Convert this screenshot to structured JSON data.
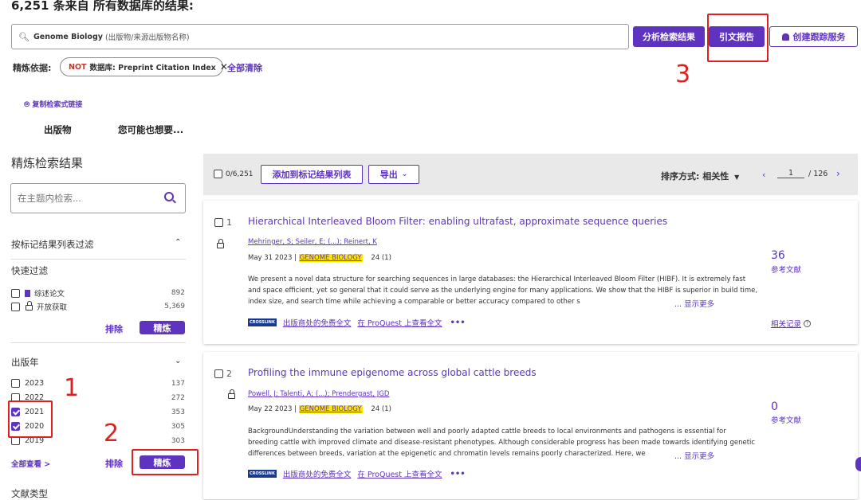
{
  "header": {
    "heading": "6,251 条来自 所有数据库的结果:",
    "search": {
      "term": "Genome Biology",
      "hint": "(出版物/来源出版物名称)"
    },
    "buttons": {
      "analyze": "分析检索结果",
      "citation_report": "引文报告",
      "create_alert": "创建跟踪服务"
    },
    "refine_label": "精炼依据:",
    "filter_chip": {
      "not": "NOT",
      "text": "数据库: Preprint Citation Index"
    },
    "clear_all": "全部清除",
    "copy_link": "复制检索式链接",
    "tabs": [
      "出版物",
      "您可能也想要..."
    ]
  },
  "annotations": {
    "one": "1",
    "two": "2",
    "three": "3"
  },
  "sidebar": {
    "title": "精炼检索结果",
    "search_placeholder": "在主题内检索...",
    "filter_by_marked": "按标记结果列表过滤",
    "quick_filter": {
      "title": "快速过滤",
      "items": [
        {
          "label": "综述论文",
          "count": "892"
        },
        {
          "label": "开放获取",
          "count": "5,369"
        }
      ],
      "exclude": "排除",
      "refine": "精炼"
    },
    "pub_years": {
      "title": "出版年",
      "items": [
        {
          "label": "2023",
          "count": "137",
          "checked": false
        },
        {
          "label": "2022",
          "count": "272",
          "checked": false
        },
        {
          "label": "2021",
          "count": "353",
          "checked": true
        },
        {
          "label": "2020",
          "count": "305",
          "checked": true
        },
        {
          "label": "2019",
          "count": "303",
          "checked": false
        }
      ],
      "see_all": "全部查看 >",
      "exclude": "排除",
      "refine": "精炼"
    },
    "doc_types_partial": "文献类型"
  },
  "toolbar": {
    "selected": "0/6,251",
    "add_to_marked": "添加到标记结果列表",
    "export": "导出",
    "sort": "排序方式: 相关性",
    "page": "1",
    "total_pages": "/ 126"
  },
  "results": [
    {
      "index": "1",
      "title": "Hierarchical Interleaved Bloom Filter: enabling ultrafast, approximate sequence queries",
      "authors": "Mehringer, S; Seiler, E; (...); Reinert, K",
      "date": "May 31 2023 |",
      "journal": "GENOME BIOLOGY",
      "volume": "24 (1)",
      "abstract": "We present a novel data structure for searching sequences in large databases: the Hierarchical Interleaved Bloom Filter (HIBF). It is extremely fast and space efficient, yet so general that it could serve as the underlying engine for many applications. We show that the HIBF is superior in build time, index size, and search time while achieving a comparable or better accuracy compared to other s",
      "show_more": "... 显示更多",
      "citations": "36",
      "citations_label": "参考文献",
      "links": [
        "出版商处的免费全文",
        "在 ProQuest 上查看全文"
      ],
      "related": "相关记录"
    },
    {
      "index": "2",
      "title": "Profiling the immune epigenome across global cattle breeds",
      "authors": "Powell, J; Talenti, A; (...); Prendergast, JGD",
      "date": "May 22 2023 |",
      "journal": "GENOME BIOLOGY",
      "volume": "24 (1)",
      "abstract": "BackgroundUnderstanding the variation between well and poorly adapted cattle breeds to local environments and pathogens is essential for breeding cattle with improved climate and disease-resistant phenotypes. Although considerable progress has been made towards identifying genetic differences between breeds, variation at the epigenetic and chromatin levels remains poorly characterized. Here, we",
      "show_more": "... 显示更多",
      "citations": "0",
      "citations_label": "参考文献",
      "links": [
        "出版商处的免费全文",
        "在 ProQuest 上查看全文"
      ]
    }
  ],
  "xref_badge": "CROSSLINK",
  "colors": {
    "accent": "#5e33bf",
    "annotation_red": "#e02020",
    "journal_highlight": "#ffe600"
  }
}
